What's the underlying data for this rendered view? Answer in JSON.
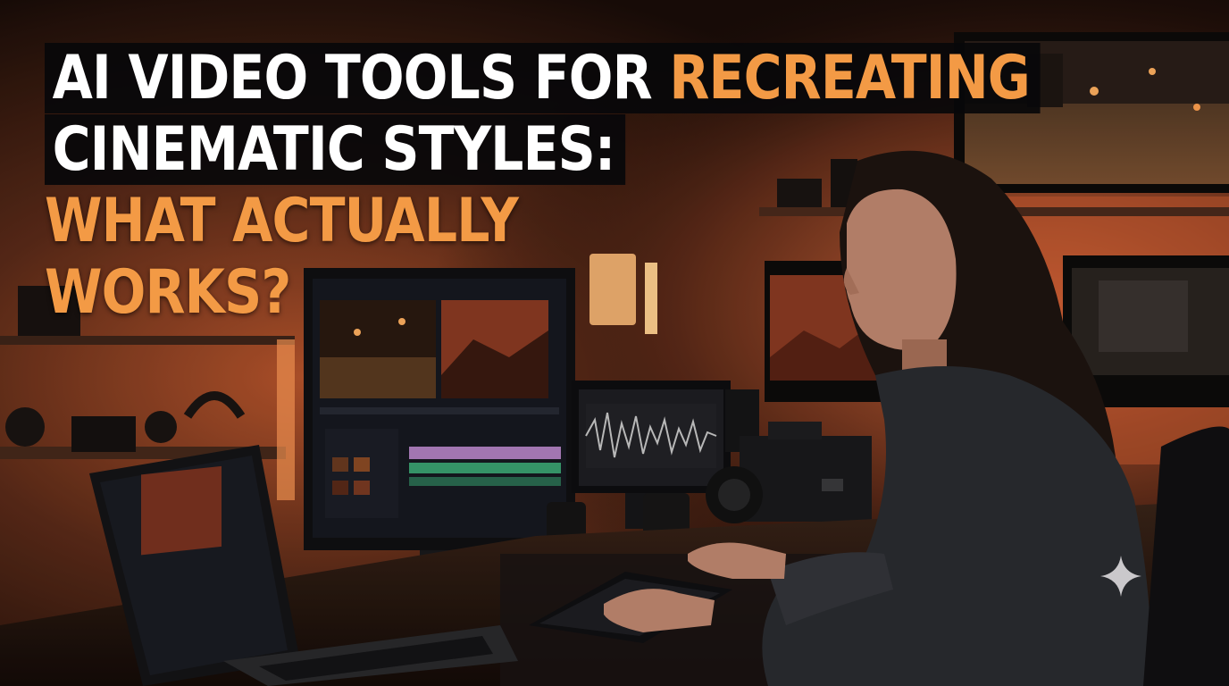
{
  "headline": {
    "line1_white": "AI VIDEO TOOLS FOR ",
    "line1_orange": "RECREATING",
    "line2_white": "CINEMATIC STYLES:",
    "line3_orange": "WHAT ACTUALLY",
    "line4_orange": "WORKS?"
  },
  "colors": {
    "accent_orange": "#f39a45",
    "text_white": "#ffffff",
    "text_band": "#08080a",
    "room_glow": "#c8582a"
  },
  "icons": [
    "sparkle-icon"
  ]
}
